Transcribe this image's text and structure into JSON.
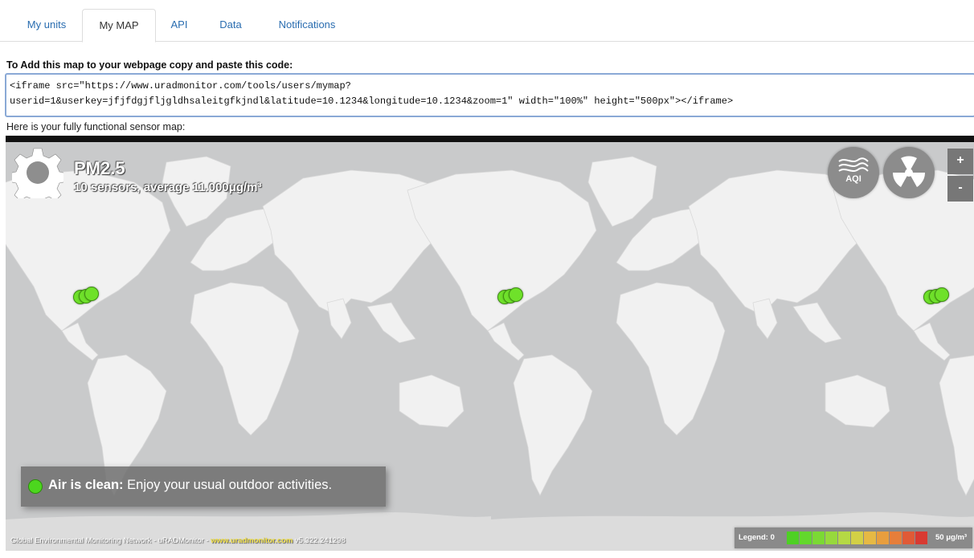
{
  "tabs": [
    {
      "label": "My units",
      "active": false
    },
    {
      "label": "My MAP",
      "active": true
    },
    {
      "label": "API",
      "active": false
    },
    {
      "label": "Data",
      "active": false
    },
    {
      "label": "Notifications",
      "active": false
    }
  ],
  "embed": {
    "heading": "To Add this map to your webpage copy and paste this code:",
    "code": "<iframe src=\"https://www.uradmonitor.com/tools/users/mymap?\nuserid=1&userkey=jfjfdgjfljgldhsaleitgfkjndl&latitude=10.1234&longitude=10.1234&zoom=1\" width=\"100%\" height=\"500px\"></iframe>"
  },
  "map_section": {
    "heading": "Here is your fully functional sensor map:"
  },
  "map": {
    "pollutant": "PM2.5",
    "summary": "10 sensors, average 11.000μg/m³",
    "aqi_button_label": "AQI",
    "zoom_in": "+",
    "zoom_out": "-",
    "status_title": "Air is clean",
    "status_separator": ":",
    "status_message": " Enjoy your usual outdoor activities.",
    "credit_text": "Global Environmental Monitoring Network - uRADMonitor - ",
    "credit_link": "www.uradmonitor.com",
    "credit_version": " v5.322.241298",
    "legend_label": "Legend: 0",
    "legend_max": "50 μg/m³",
    "legend_colors": [
      "#4ed024",
      "#63d82c",
      "#7bd934",
      "#97d93c",
      "#b5d944",
      "#d3d046",
      "#e6b944",
      "#e89e3e",
      "#e67e3a",
      "#e05a36",
      "#d83a32"
    ],
    "colors": {
      "water": "#c9cacb",
      "land": "#f1f1f1",
      "marker": "#6fe12a"
    },
    "icons": [
      "gear-icon",
      "aqi-icon",
      "radiation-icon"
    ]
  }
}
